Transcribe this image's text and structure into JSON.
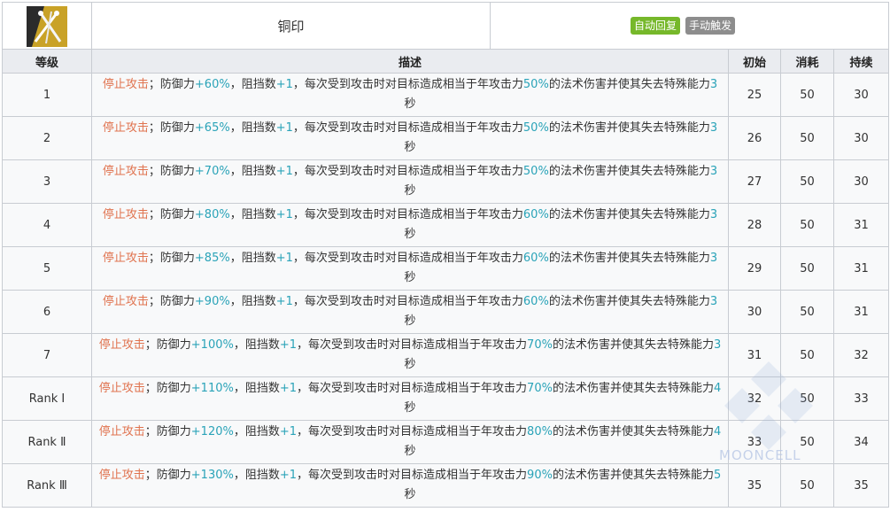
{
  "skill": {
    "icon": "crossed-swords-icon",
    "name": "铜印",
    "tags": [
      "自动回复",
      "手动触发"
    ],
    "tag_colors": [
      "#76b82a",
      "#8d8d8d"
    ]
  },
  "table": {
    "headers": [
      "等级",
      "描述",
      "初始",
      "消耗",
      "持续"
    ],
    "desc_parts": {
      "stop": "停止攻击",
      "p1": "；防御力",
      "p2": "，阻挡数",
      "block": "+1",
      "p3": "，每次受到攻击时对目标造成相当于年攻击力",
      "p4": "的法术伤害并使其失去特殊能力",
      "sec": "秒"
    },
    "rows": [
      {
        "level": "1",
        "def": "+60%",
        "dmg": "50%",
        "dur": "3",
        "initial": "25",
        "cost": "50",
        "duration": "30"
      },
      {
        "level": "2",
        "def": "+65%",
        "dmg": "50%",
        "dur": "3",
        "initial": "26",
        "cost": "50",
        "duration": "30"
      },
      {
        "level": "3",
        "def": "+70%",
        "dmg": "50%",
        "dur": "3",
        "initial": "27",
        "cost": "50",
        "duration": "30"
      },
      {
        "level": "4",
        "def": "+80%",
        "dmg": "60%",
        "dur": "3",
        "initial": "28",
        "cost": "50",
        "duration": "31"
      },
      {
        "level": "5",
        "def": "+85%",
        "dmg": "60%",
        "dur": "3",
        "initial": "29",
        "cost": "50",
        "duration": "31"
      },
      {
        "level": "6",
        "def": "+90%",
        "dmg": "60%",
        "dur": "3",
        "initial": "30",
        "cost": "50",
        "duration": "31"
      },
      {
        "level": "7",
        "def": "+100%",
        "dmg": "70%",
        "dur": "3",
        "initial": "31",
        "cost": "50",
        "duration": "32"
      },
      {
        "level": "Rank Ⅰ",
        "def": "+110%",
        "dmg": "70%",
        "dur": "4",
        "initial": "32",
        "cost": "50",
        "duration": "33"
      },
      {
        "level": "Rank Ⅱ",
        "def": "+120%",
        "dmg": "80%",
        "dur": "4",
        "initial": "33",
        "cost": "50",
        "duration": "34"
      },
      {
        "level": "Rank Ⅲ",
        "def": "+130%",
        "dmg": "90%",
        "dur": "5",
        "initial": "35",
        "cost": "50",
        "duration": "35"
      }
    ]
  },
  "watermark": "MOONCELL"
}
